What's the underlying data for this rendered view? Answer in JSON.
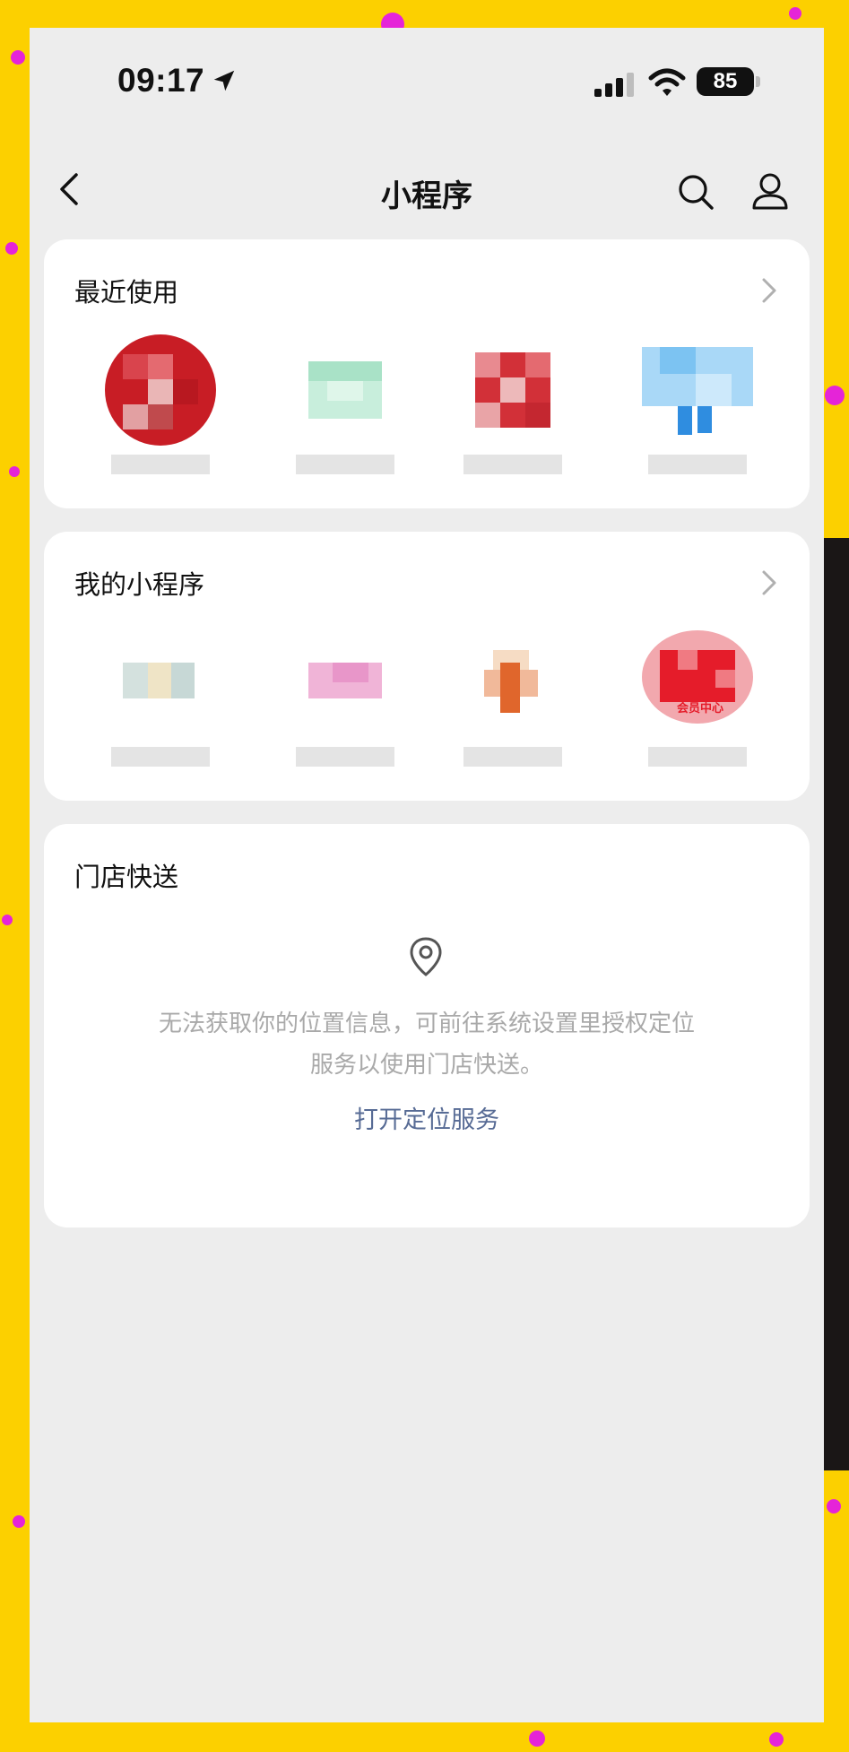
{
  "status_bar": {
    "time": "09:17",
    "battery": "85"
  },
  "nav": {
    "title": "小程序",
    "icons": [
      "back-icon",
      "search-icon",
      "profile-icon"
    ]
  },
  "recent": {
    "title": "最近使用",
    "apps": [
      {
        "icon_color": "#c81d25"
      },
      {
        "icon_color": "#b8e9d2"
      },
      {
        "icon_color": "#d23038"
      },
      {
        "icon_color": "#7cc3f2"
      }
    ]
  },
  "mine": {
    "title": "我的小程序",
    "apps": [
      {
        "icon_color": "#c7d8d6"
      },
      {
        "icon_color": "#e896c9"
      },
      {
        "icon_color": "#e0662c"
      },
      {
        "icon_color": "#e51c2a",
        "badge": "会员中心"
      }
    ]
  },
  "store": {
    "title": "门店快送",
    "message": "无法获取你的位置信息，可前往系统设置里授权定位服务以使用门店快送。",
    "link": "打开定位服务"
  },
  "colors": {
    "frame": "#fcd000",
    "page_bg": "#ededed",
    "card_bg": "#ffffff",
    "link": "#576b95"
  }
}
